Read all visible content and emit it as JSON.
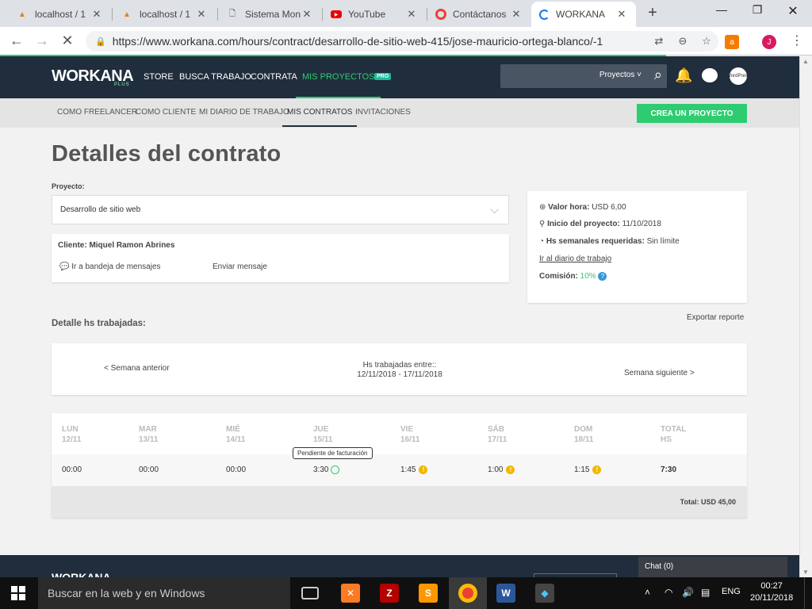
{
  "browser": {
    "tabs": [
      {
        "title": "localhost / 1",
        "icon": "phpmyadmin-icon"
      },
      {
        "title": "localhost / 1",
        "icon": "phpmyadmin-icon"
      },
      {
        "title": "Sistema Mon",
        "icon": "document-icon"
      },
      {
        "title": "YouTube",
        "icon": "youtube-icon"
      },
      {
        "title": "Contáctanos",
        "icon": "chrome-icon"
      },
      {
        "title": "WORKANA",
        "icon": "loading-icon"
      }
    ],
    "url": "https://www.workana.com/hours/contract/desarrollo-de-sitio-web-415/jose-mauricio-ortega-blanco/-1",
    "profile_initial": "J"
  },
  "workana_nav": {
    "logo": "WORKANA",
    "logo_sub": "PLUS",
    "links": [
      "STORE",
      "BUSCA TRABAJO",
      "CONTRATA",
      "MIS PROYECTOS"
    ],
    "pro_badge": "PRO",
    "search_select": "Proyectos",
    "avatar_text": "WordPress"
  },
  "subnav": {
    "links": [
      "COMO FREELANCER",
      "COMO CLIENTE",
      "MI DIARIO DE TRABAJO",
      "MIS CONTRATOS",
      "INVITACIONES"
    ],
    "create_button": "CREA UN PROYECTO"
  },
  "page": {
    "title": "Detalles del contrato",
    "project_label": "Proyecto:",
    "project_value": "Desarrollo de sitio web",
    "client_label": "Cliente:",
    "client_name": "Miquel Ramon Abrines",
    "inbox_link": "Ir a bandeja de mensajes",
    "send_message": "Enviar mensaje"
  },
  "info": {
    "rate_label": "Valor hora:",
    "rate_value": "USD 6,00",
    "start_label": "Inicio del proyecto:",
    "start_value": "11/10/2018",
    "weekly_label": "Hs semanales requeridas:",
    "weekly_value": "Sin límite",
    "diary_link": "Ir al diario de trabajo",
    "commission_label": "Comisión:",
    "commission_value": "10%"
  },
  "hours": {
    "section_title": "Detalle hs trabajadas:",
    "export_link": "Exportar reporte",
    "prev_week": "< Semana anterior",
    "range_label": "Hs trabajadas entre::",
    "range_value": "12/11/2018 - 17/11/2018",
    "next_week": "Semana siguiente >",
    "days": [
      {
        "name": "LUN",
        "date": "12/11",
        "value": "00:00",
        "status": ""
      },
      {
        "name": "MAR",
        "date": "13/11",
        "value": "00:00",
        "status": ""
      },
      {
        "name": "MIÉ",
        "date": "14/11",
        "value": "00:00",
        "status": ""
      },
      {
        "name": "JUE",
        "date": "15/11",
        "value": "3:30",
        "status": "pending"
      },
      {
        "name": "VIE",
        "date": "16/11",
        "value": "1:45",
        "status": "warning"
      },
      {
        "name": "SÁB",
        "date": "17/11",
        "value": "1:00",
        "status": "warning"
      },
      {
        "name": "DOM",
        "date": "18/11",
        "value": "1:15",
        "status": "warning"
      }
    ],
    "total_header": "TOTAL",
    "total_header_sub": "HS",
    "total_value": "7:30",
    "tooltip": "Pendiente de facturación",
    "total_amount": "Total: USD 45,00"
  },
  "footer": {
    "logo": "WORKANA",
    "chat": "Chat (0)"
  },
  "taskbar": {
    "search_placeholder": "Buscar en la web y en Windows",
    "language": "ENG",
    "time": "00:27",
    "date": "20/11/2018"
  },
  "colors": {
    "brand_dark": "#1f2d3d",
    "accent_green": "#2ecc71",
    "warning": "#f1b800",
    "help_blue": "#3498db"
  }
}
